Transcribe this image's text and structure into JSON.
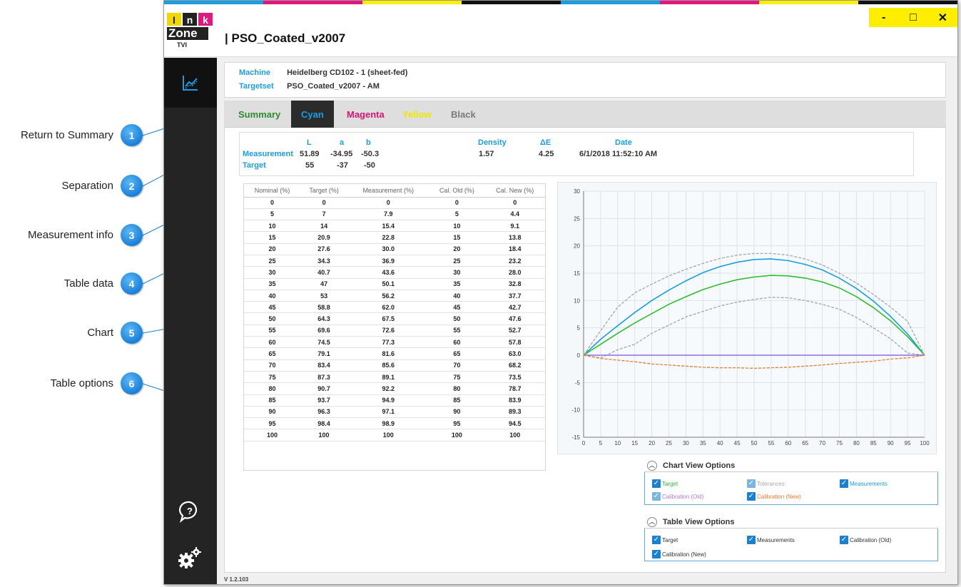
{
  "callouts": [
    {
      "num": "1",
      "label": "Return to Summary"
    },
    {
      "num": "2",
      "label": "Separation"
    },
    {
      "num": "3",
      "label": "Measurement info"
    },
    {
      "num": "4",
      "label": "Table data"
    },
    {
      "num": "5",
      "label": "Chart"
    },
    {
      "num": "6",
      "label": "Table options"
    }
  ],
  "logo": {
    "letters": [
      "I",
      "n",
      "k"
    ],
    "word": "Zone",
    "sub": "TVI"
  },
  "window": {
    "title": "| PSO_Coated_v2007",
    "controls": {
      "minimize": "-",
      "maximize": "□",
      "close": "✕"
    },
    "topstrip_colors": [
      "#1b9de2",
      "#e0177f",
      "#ffee00",
      "#111111",
      "#1b9de2",
      "#e0177f",
      "#ffee00",
      "#111111"
    ]
  },
  "machine": {
    "machine_label": "Machine",
    "machine_value": "Heidelberg CD102 - 1 (sheet-fed)",
    "targetset_label": "Targetset",
    "targetset_value": "PSO_Coated_v2007 - AM"
  },
  "tabs": [
    {
      "label": "Summary",
      "color": "#2e8b2e"
    },
    {
      "label": "Cyan",
      "color": "#1b9de2"
    },
    {
      "label": "Magenta",
      "color": "#d4147a"
    },
    {
      "label": "Yellow",
      "color": "#f2e600"
    },
    {
      "label": "Black",
      "color": "#7a7a7a"
    }
  ],
  "measurement": {
    "headers": {
      "L": "L",
      "a": "a",
      "b": "b",
      "density": "Density",
      "de": "ΔE",
      "date": "Date"
    },
    "measurement_label": "Measurement",
    "target_label": "Target",
    "measurement": {
      "L": "51.89",
      "a": "-34.95",
      "b": "-50.3",
      "density": "1.57",
      "de": "4.25",
      "date": "6/1/2018 11:52:10 AM"
    },
    "target": {
      "L": "55",
      "a": "-37",
      "b": "-50"
    }
  },
  "table": {
    "headers": [
      "Nominal (%)",
      "Target (%)",
      "Measurement (%)",
      "Cal. Old (%)",
      "Cal. New (%)"
    ],
    "rows": [
      [
        "0",
        "0",
        "0",
        "0",
        "0"
      ],
      [
        "5",
        "7",
        "7.9",
        "5",
        "4.4"
      ],
      [
        "10",
        "14",
        "15.4",
        "10",
        "9.1"
      ],
      [
        "15",
        "20.9",
        "22.8",
        "15",
        "13.8"
      ],
      [
        "20",
        "27.6",
        "30.0",
        "20",
        "18.4"
      ],
      [
        "25",
        "34.3",
        "36.9",
        "25",
        "23.2"
      ],
      [
        "30",
        "40.7",
        "43.6",
        "30",
        "28.0"
      ],
      [
        "35",
        "47",
        "50.1",
        "35",
        "32.8"
      ],
      [
        "40",
        "53",
        "56.2",
        "40",
        "37.7"
      ],
      [
        "45",
        "58.8",
        "62.0",
        "45",
        "42.7"
      ],
      [
        "50",
        "64.3",
        "67.5",
        "50",
        "47.6"
      ],
      [
        "55",
        "69.6",
        "72.6",
        "55",
        "52.7"
      ],
      [
        "60",
        "74.5",
        "77.3",
        "60",
        "57.8"
      ],
      [
        "65",
        "79.1",
        "81.6",
        "65",
        "63.0"
      ],
      [
        "70",
        "83.4",
        "85.6",
        "70",
        "68.2"
      ],
      [
        "75",
        "87.3",
        "89.1",
        "75",
        "73.5"
      ],
      [
        "80",
        "90.7",
        "92.2",
        "80",
        "78.7"
      ],
      [
        "85",
        "93.7",
        "94.9",
        "85",
        "83.9"
      ],
      [
        "90",
        "96.3",
        "97.1",
        "90",
        "89.3"
      ],
      [
        "95",
        "98.4",
        "98.9",
        "95",
        "94.5"
      ],
      [
        "100",
        "100",
        "100",
        "100",
        "100"
      ]
    ]
  },
  "chart_data": {
    "type": "line",
    "x": [
      0,
      5,
      10,
      15,
      20,
      25,
      30,
      35,
      40,
      45,
      50,
      55,
      60,
      65,
      70,
      75,
      80,
      85,
      90,
      95,
      100
    ],
    "xlim": [
      0,
      100
    ],
    "ylim": [
      -15,
      30
    ],
    "xticks": [
      "0",
      "5",
      "10",
      "15",
      "20",
      "25",
      "30",
      "35",
      "40",
      "45",
      "50",
      "55",
      "60",
      "65",
      "70",
      "75",
      "80",
      "85",
      "90",
      "95",
      "100"
    ],
    "yticks": [
      "30",
      "25",
      "20",
      "15",
      "10",
      "5",
      "0",
      "-5",
      "-10",
      "-15"
    ],
    "grid": true,
    "series": [
      {
        "color": "#1b9de2",
        "style": "solid",
        "values": [
          0,
          2.9,
          5.4,
          7.8,
          10,
          11.9,
          13.6,
          15.1,
          16.2,
          17.0,
          17.5,
          17.6,
          17.3,
          16.6,
          15.6,
          14.1,
          12.2,
          9.9,
          7.1,
          3.9,
          0
        ]
      },
      {
        "color": "#2ebd2e",
        "style": "solid",
        "values": [
          0,
          2,
          4,
          5.9,
          7.6,
          9.3,
          10.7,
          12,
          13,
          13.8,
          14.3,
          14.6,
          14.5,
          14.1,
          13.4,
          12.3,
          10.7,
          8.7,
          6.3,
          3.4,
          0
        ]
      },
      {
        "color": "#a6a6a6",
        "style": "dashed",
        "values": [
          0,
          4.5,
          8.8,
          11.4,
          13,
          14.5,
          15.7,
          16.8,
          17.7,
          18.3,
          18.6,
          18.6,
          18.3,
          17.6,
          16.5,
          15,
          13.2,
          11.1,
          8.8,
          6.2,
          0
        ]
      },
      {
        "color": "#a6a6a6",
        "style": "dashed",
        "values": [
          0,
          -0.5,
          1,
          2,
          4,
          5.5,
          7,
          8,
          9,
          9.7,
          10.2,
          10.6,
          10.5,
          10,
          9.3,
          8.4,
          6.9,
          5,
          3,
          0.4,
          0
        ]
      },
      {
        "color": "#8a6ee0",
        "style": "solid",
        "values": [
          0,
          0,
          0,
          0,
          0,
          0,
          0,
          0,
          0,
          0,
          0,
          0,
          0,
          0,
          0,
          0,
          0,
          0,
          0,
          0,
          0
        ]
      },
      {
        "color": "#f07830",
        "style": "dashed",
        "values": [
          0,
          -0.6,
          -0.9,
          -1.2,
          -1.6,
          -1.8,
          -2,
          -2.2,
          -2.3,
          -2.3,
          -2.4,
          -2.3,
          -2.2,
          -2,
          -1.8,
          -1.5,
          -1.3,
          -1.1,
          -0.7,
          -0.5,
          0
        ]
      }
    ]
  },
  "chart_options": {
    "title": "Chart View Options",
    "items": [
      {
        "label": "Target",
        "color": "#2ebd2e",
        "checked": true
      },
      {
        "label": "Tolerances",
        "color": "#a9a9a9",
        "checked": true
      },
      {
        "label": "Measurements",
        "color": "#1b9de2",
        "checked": true
      },
      {
        "label": "Calibration (Old)",
        "color": "#b57ad6",
        "checked": true
      },
      {
        "label": "Calibration (New)",
        "color": "#f07830",
        "checked": true
      }
    ]
  },
  "table_options": {
    "title": "Table View Options",
    "items": [
      {
        "label": "Target",
        "checked": true
      },
      {
        "label": "Measurements",
        "checked": true
      },
      {
        "label": "Calibration (Old)",
        "checked": true
      },
      {
        "label": "Calibration (New)",
        "checked": true
      }
    ]
  },
  "version": "V 1.2.103",
  "icons": {
    "sidebar_active": "chart-line-icon",
    "help": "help-bubble-icon",
    "settings": "gears-icon",
    "chevron": "chevron-up-icon",
    "check": "checkbox-check-icon"
  }
}
